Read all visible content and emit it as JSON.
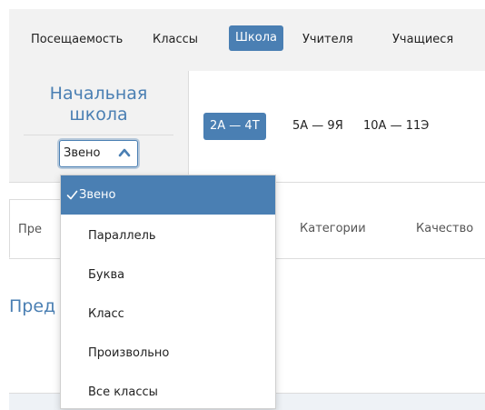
{
  "nav": {
    "items": [
      "Посещаемость",
      "Классы",
      "Школа",
      "Учителя",
      "Учащиеся"
    ],
    "active": "Школа"
  },
  "level": {
    "title_line1": "Начальная",
    "title_line2": "школа",
    "select_value": "Звено"
  },
  "ranges": {
    "items": [
      "2А — 4Т",
      "5А — 9Я",
      "10А — 11Э"
    ],
    "active": "2А — 4Т"
  },
  "tabs": {
    "items": [
      "Пре",
      "Категории",
      "Качество"
    ]
  },
  "page": {
    "heading": "Пред"
  },
  "dropdown": {
    "options": [
      "Звено",
      "Параллель",
      "Буква",
      "Класс",
      "Произвольно",
      "Все классы"
    ],
    "selected": "Звено"
  },
  "colors": {
    "accent": "#4a7fb3",
    "panel_bg": "#f2f2f2"
  }
}
